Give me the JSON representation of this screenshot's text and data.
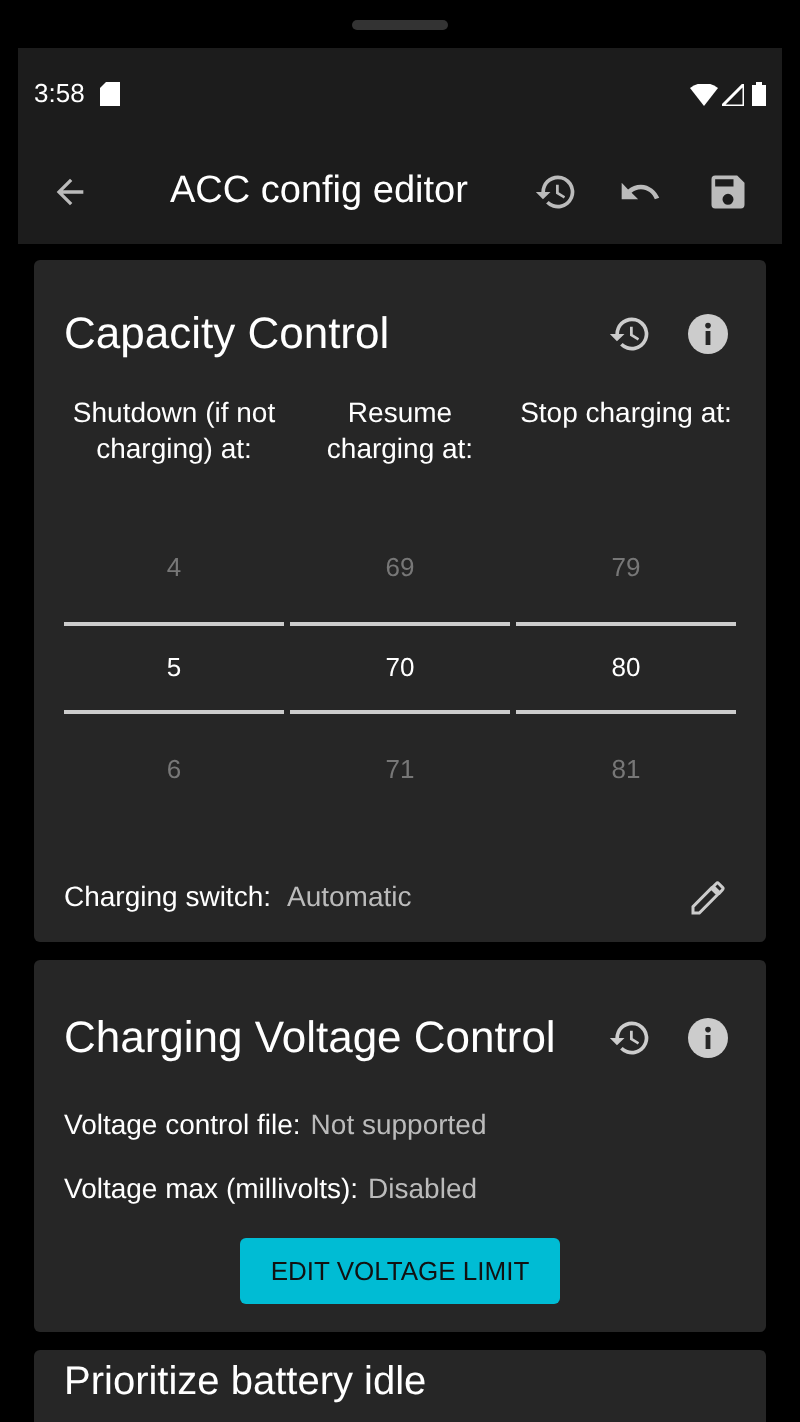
{
  "status_bar": {
    "time": "3:58"
  },
  "toolbar": {
    "title": "ACC config editor"
  },
  "capacity_card": {
    "title": "Capacity Control",
    "pickers": [
      {
        "label": "Shutdown (if not charging) at:",
        "values": [
          "4",
          "5",
          "6"
        ]
      },
      {
        "label": "Resume charging at:",
        "values": [
          "69",
          "70",
          "71"
        ]
      },
      {
        "label": "Stop charging at:",
        "values": [
          "79",
          "80",
          "81"
        ]
      }
    ],
    "charging_switch": {
      "label": "Charging switch:",
      "value": "Automatic"
    }
  },
  "voltage_card": {
    "title": "Charging Voltage Control",
    "rows": [
      {
        "label": "Voltage control file:",
        "value": "Not supported"
      },
      {
        "label": "Voltage max (millivolts):",
        "value": "Disabled"
      }
    ],
    "button": "EDIT VOLTAGE LIMIT"
  },
  "idle_card": {
    "title": "Prioritize battery idle"
  }
}
